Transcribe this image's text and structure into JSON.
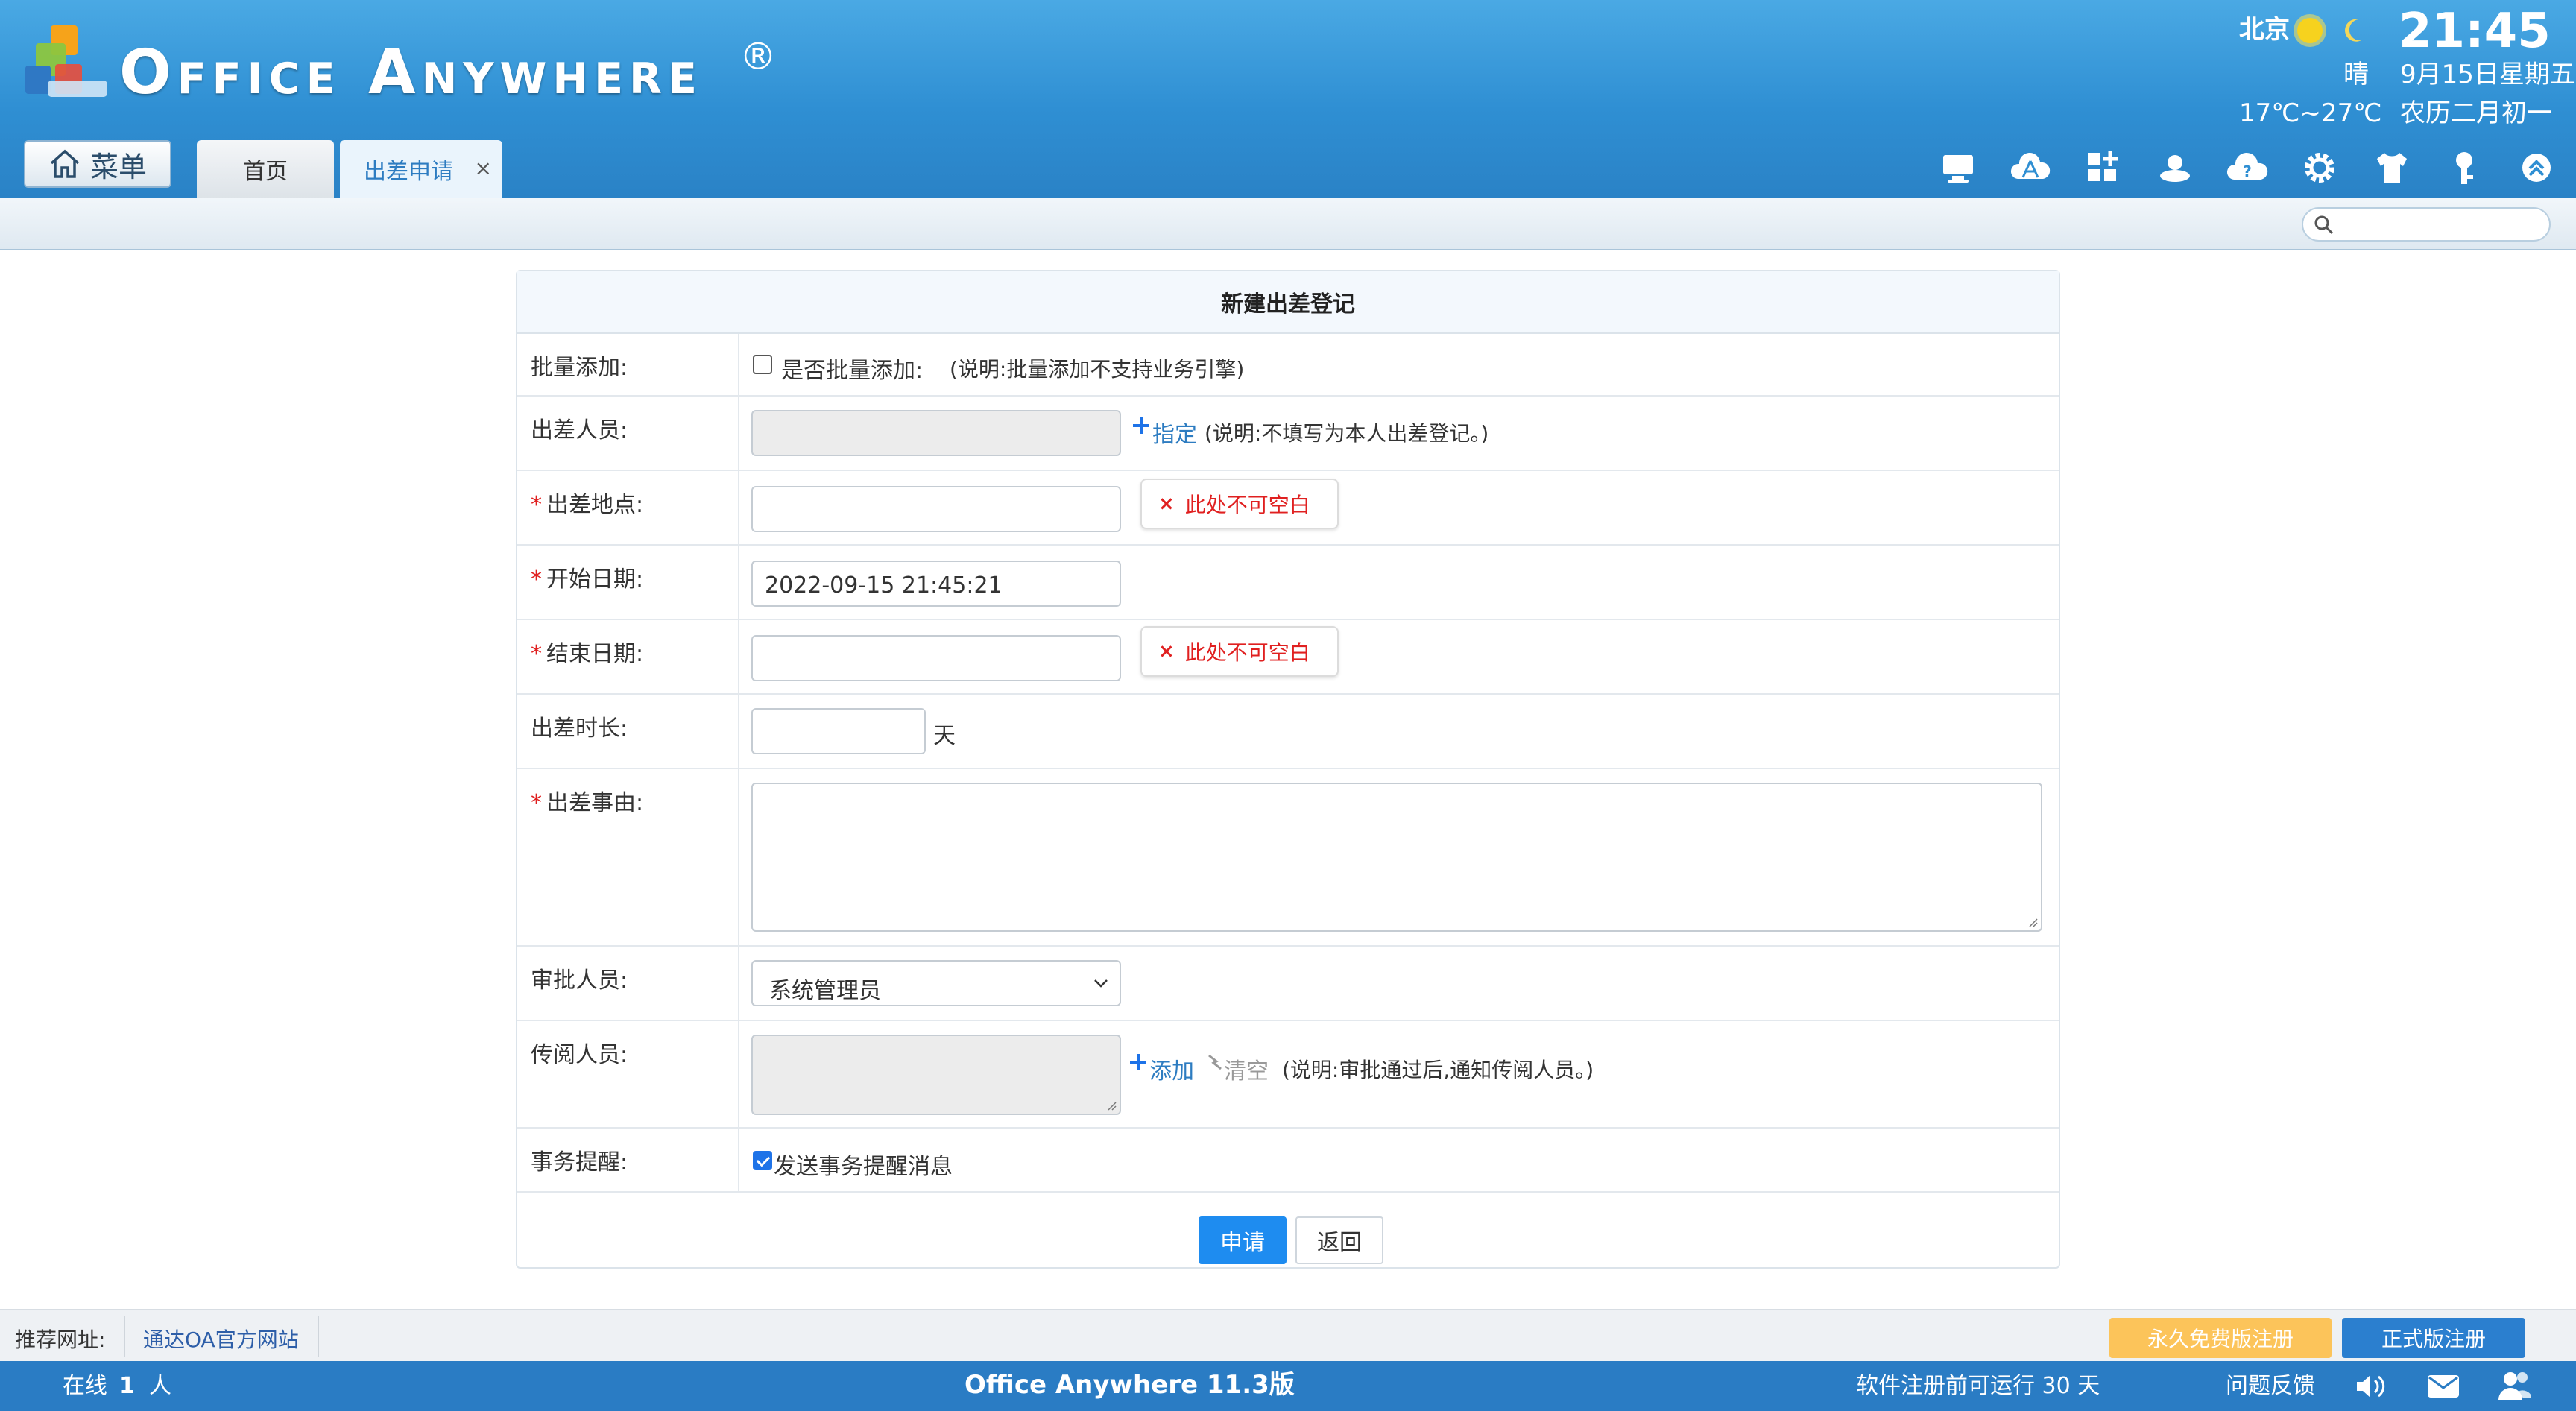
{
  "header": {
    "brand": "Office Anywhere",
    "registered_mark": "®",
    "weather": {
      "city": "北京",
      "condition": "晴",
      "temp": "17℃~27℃"
    },
    "clock": {
      "time": "21:45",
      "date": "9月15日星期五",
      "lunar": "农历二月初一"
    },
    "menu_label": "菜单",
    "tabs": [
      {
        "label": "首页"
      },
      {
        "label": "出差申请",
        "close": "×"
      }
    ],
    "toolbar_icons": [
      "desktop-icon",
      "cloud-network-icon",
      "apps-add-icon",
      "user-disk-icon",
      "help-cloud-icon",
      "settings-gear-icon",
      "shirt-theme-icon",
      "key-icon",
      "collapse-up-icon"
    ]
  },
  "search": {
    "placeholder": ""
  },
  "form": {
    "title": "新建出差登记",
    "rows": {
      "batch": {
        "label": "批量添加:",
        "checkbox_label": "是否批量添加:",
        "hint": "(说明:批量添加不支持业务引擎)",
        "checked": false
      },
      "traveler": {
        "label": "出差人员:",
        "link": "指定",
        "hint": "(说明:不填写为本人出差登记。)"
      },
      "location": {
        "label": "出差地点:",
        "required": "*",
        "error": "此处不可空白",
        "error_icon": "×"
      },
      "start_date": {
        "label": "开始日期:",
        "required": "*",
        "value": "2022-09-15 21:45:21"
      },
      "end_date": {
        "label": "结束日期:",
        "required": "*",
        "error": "此处不可空白",
        "error_icon": "×"
      },
      "duration": {
        "label": "出差时长:",
        "unit": "天"
      },
      "reason": {
        "label": "出差事由:",
        "required": "*"
      },
      "approver": {
        "label": "审批人员:",
        "selected": "系统管理员"
      },
      "circulate": {
        "label": "传阅人员:",
        "add": "添加",
        "clear": "清空",
        "hint": "(说明:审批通过后,通知传阅人员。)"
      },
      "reminder": {
        "label": "事务提醒:",
        "checkbox_label": "发送事务提醒消息",
        "checked": true
      }
    },
    "submit": "申请",
    "back": "返回"
  },
  "linkbar": {
    "label": "推荐网址:",
    "link": "通达OA官方网站",
    "free_reg": "永久免费版注册",
    "formal_reg": "正式版注册"
  },
  "statusbar": {
    "online_prefix": "在线",
    "online_count": "1",
    "online_suffix": "人",
    "version": "Office Anywhere 11.3版",
    "trial": "软件注册前可运行 30 天",
    "feedback": "问题反馈"
  }
}
